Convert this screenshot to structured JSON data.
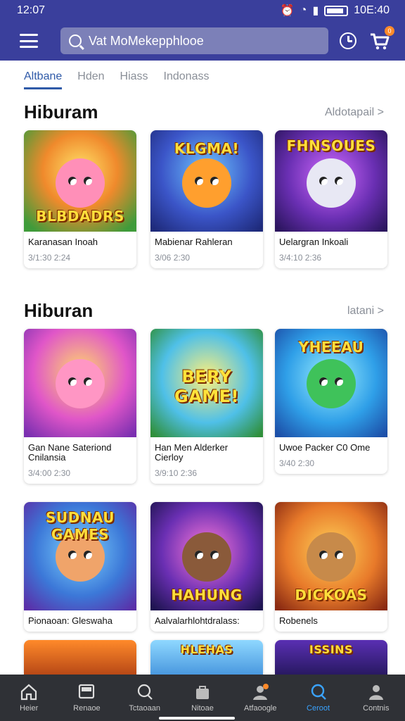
{
  "status": {
    "time": "12:07",
    "right_text": "10E:40"
  },
  "search": {
    "text": "Vat MoMekepphlooe"
  },
  "cart": {
    "badge": "0"
  },
  "tabs": [
    "Altbane",
    "Hden",
    "Hiass",
    "Indonass"
  ],
  "sections": [
    {
      "title": "Hiburam",
      "see_all": "Aldotapail >"
    },
    {
      "title": "Hiburan",
      "see_all": "latani >"
    }
  ],
  "cards": [
    {
      "name": "Karanasan Inoah",
      "meta": "3/1:30 2:24",
      "logo": "BLBDADRS"
    },
    {
      "name": "Mabienar Rahleran",
      "meta": "3/06 2:30",
      "logo": "KLGMA!"
    },
    {
      "name": "Uelargran Inkoali",
      "meta": "3/4:10 2:36",
      "logo": "FHNSOUES"
    },
    {
      "name": "Gan Nane Sateriond Cnilansia",
      "meta": "3/4:00 2:30",
      "logo": ""
    },
    {
      "name": "Han Men Alderker Cierloy",
      "meta": "3/9:10 2:36",
      "logo": "BERY GAME!"
    },
    {
      "name": "Uwoe Packer C0 Ome",
      "meta": "3/40 2:30",
      "logo": "YHEEAU"
    },
    {
      "name": "Pionaoan: Gleswaha",
      "meta": "",
      "logo": "SUDNAU GAMES"
    },
    {
      "name": "Aalvalarhlohtdralass:",
      "meta": "",
      "logo": "HAHUNG"
    },
    {
      "name": "Robenels",
      "meta": "",
      "logo": "DICKOAS"
    },
    {
      "name": "",
      "meta": "",
      "logo": ""
    },
    {
      "name": "",
      "meta": "",
      "logo": "HLEHAS"
    },
    {
      "name": "",
      "meta": "",
      "logo": "ISSINS"
    }
  ],
  "nav": [
    {
      "label": "Heier",
      "icon": "home-icon"
    },
    {
      "label": "Renaoe",
      "icon": "tv-icon"
    },
    {
      "label": "Tctaoaan",
      "icon": "search-icon"
    },
    {
      "label": "Nitoae",
      "icon": "bag-icon"
    },
    {
      "label": "Atfaoogle",
      "icon": "person-icon"
    },
    {
      "label": "Ceroot",
      "icon": "search-icon"
    },
    {
      "label": "Contnis",
      "icon": "account-icon"
    }
  ],
  "colors": {
    "header": "#3a3f9c",
    "accent": "#2f5aa8",
    "nav_bg": "#2f3136",
    "nav_active": "#3aa3ff",
    "badge": "#ff8a2a"
  }
}
